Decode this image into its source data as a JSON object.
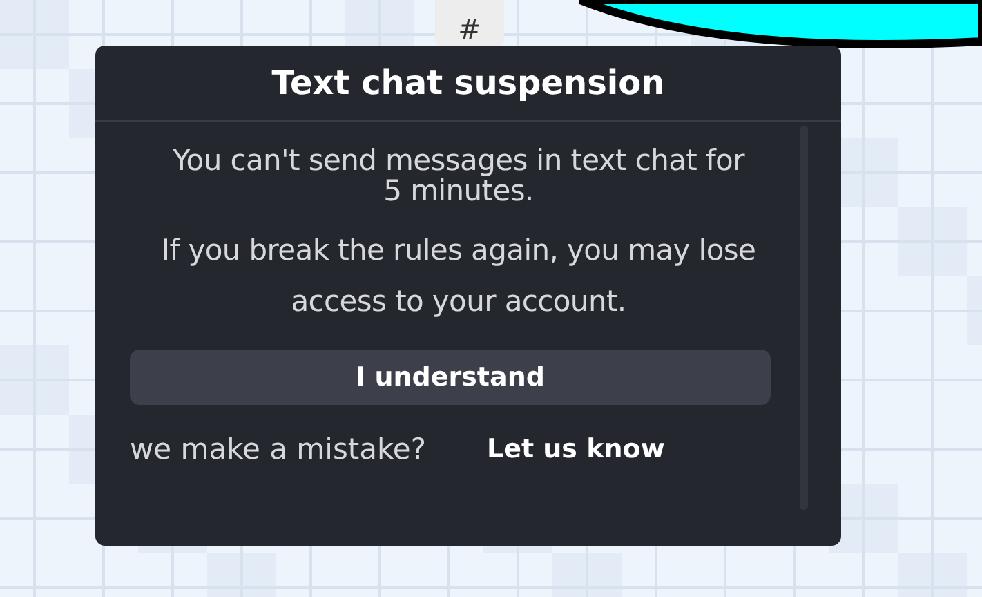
{
  "tab": {
    "label": "#"
  },
  "dialog": {
    "title": "Text chat suspension",
    "paragraphs": [
      "You can't send messages in text chat for 5 minutes.",
      "If you break the rules again, you may lose access to your account."
    ],
    "button": "I understand",
    "footer_text": "we make a mistake?",
    "footer_link": "Let us know"
  }
}
